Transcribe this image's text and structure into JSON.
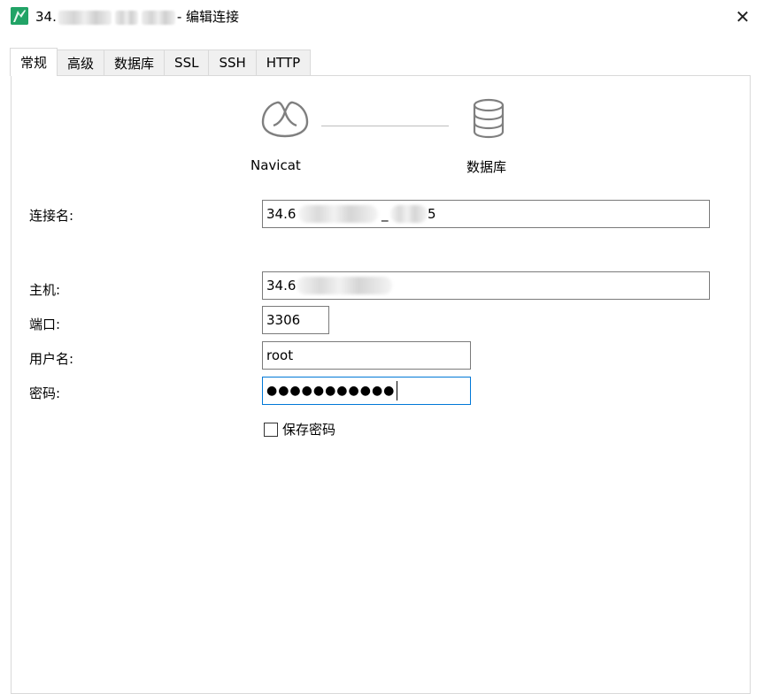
{
  "window": {
    "title_prefix": "34.",
    "title_suffix": "- 编辑连接",
    "close_glyph": "✕"
  },
  "tabs": [
    {
      "label": "常规",
      "active": true
    },
    {
      "label": "高级",
      "active": false
    },
    {
      "label": "数据库",
      "active": false
    },
    {
      "label": "SSL",
      "active": false
    },
    {
      "label": "SSH",
      "active": false
    },
    {
      "label": "HTTP",
      "active": false
    }
  ],
  "graphic": {
    "left_label": "Navicat",
    "right_label": "数据库",
    "left_icon": "navicat-logo-icon",
    "right_icon": "database-icon"
  },
  "form": {
    "connection_name": {
      "label": "连接名:",
      "value_prefix": "34.6",
      "value_mid": "_",
      "value_suffix": "5"
    },
    "host": {
      "label": "主机:",
      "value_prefix": "34.6"
    },
    "port": {
      "label": "端口:",
      "value": "3306"
    },
    "username": {
      "label": "用户名:",
      "value": "root"
    },
    "password": {
      "label": "密码:",
      "masked": "●●●●●●●●●●●"
    },
    "save_password": {
      "label": "保存密码",
      "checked": false
    }
  },
  "colors": {
    "focus_border": "#0078d7",
    "app_icon": "#21a366"
  }
}
